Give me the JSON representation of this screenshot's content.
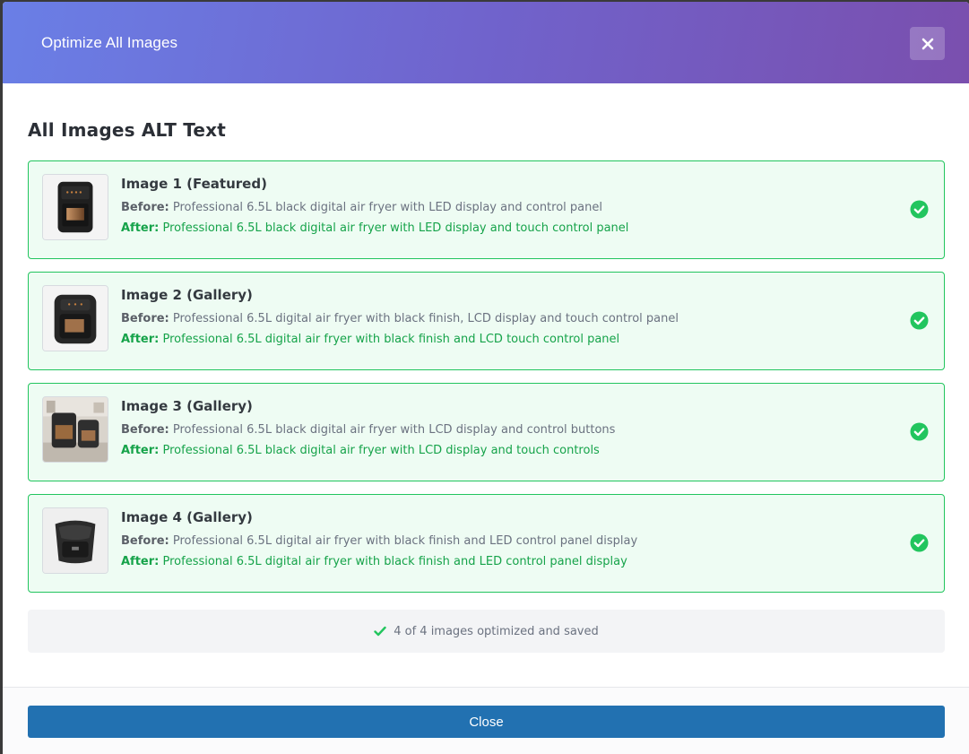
{
  "modal": {
    "title": "Optimize All Images",
    "close_icon": "close-icon"
  },
  "section_title": "All Images ALT Text",
  "labels": {
    "before": "Before:",
    "after": "After:"
  },
  "images": [
    {
      "title": "Image 1 (Featured)",
      "before": "Professional 6.5L black digital air fryer with LED display and control panel",
      "after": "Professional 6.5L black digital air fryer with LED display and touch control panel",
      "status_icon": "check-circle-icon"
    },
    {
      "title": "Image 2 (Gallery)",
      "before": "Professional 6.5L digital air fryer with black finish, LCD display and touch control panel",
      "after": "Professional 6.5L digital air fryer with black finish and LCD touch control panel",
      "status_icon": "check-circle-icon"
    },
    {
      "title": "Image 3 (Gallery)",
      "before": "Professional 6.5L black digital air fryer with LCD display and control buttons",
      "after": "Professional 6.5L black digital air fryer with LCD display and touch controls",
      "status_icon": "check-circle-icon"
    },
    {
      "title": "Image 4 (Gallery)",
      "before": "Professional 6.5L digital air fryer with black finish and LED control panel display",
      "after": "Professional 6.5L digital air fryer with black finish and LED control panel display",
      "status_icon": "check-circle-icon"
    }
  ],
  "summary": {
    "text": "4 of 4 images optimized and saved",
    "icon": "checkmark-icon"
  },
  "footer": {
    "close_label": "Close"
  },
  "colors": {
    "header_gradient_start": "#6a7fe6",
    "header_gradient_end": "#7a4fae",
    "success": "#22c55e",
    "after_text": "#16a34a",
    "primary_button": "#2271b1"
  }
}
